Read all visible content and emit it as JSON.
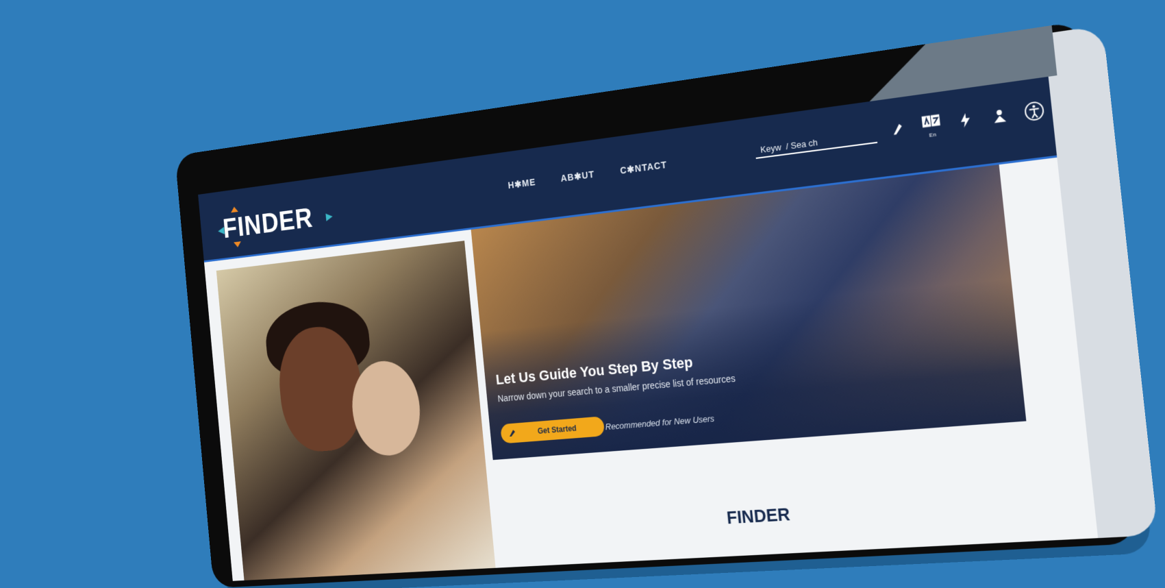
{
  "brand": {
    "logo_text": "FINDER"
  },
  "nav": {
    "items": [
      {
        "label": "H✱ME"
      },
      {
        "label": "AB✱UT"
      },
      {
        "label": "C✱NTACT"
      }
    ]
  },
  "search": {
    "placeholder": "Keyw  / Sea ch"
  },
  "header_icons": {
    "items": [
      "pen-icon",
      "language-icon",
      "bolt-icon",
      "user-icon",
      "accessibility-icon"
    ],
    "language_label": "En"
  },
  "hero": {
    "title": "Let Us Guide You Step By Step",
    "subtitle": "Narrow down your search to a smaller precise list of resources",
    "button_label": "Get  Started",
    "note": "Recommended for New Users"
  },
  "section": {
    "heading": "FINDER"
  },
  "colors": {
    "background": "#2f7dbb",
    "topbar": "#172a4e",
    "accent": "#f2a81b",
    "logo_orange": "#f08a24",
    "logo_teal": "#3bb7c7"
  }
}
